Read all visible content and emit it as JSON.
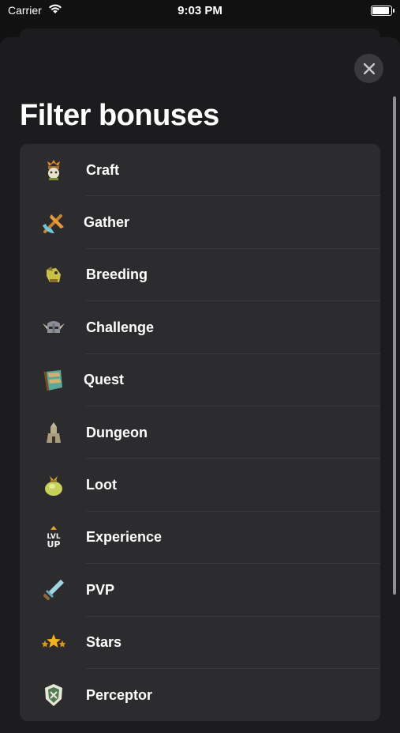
{
  "status": {
    "carrier": "Carrier",
    "time": "9:03 PM"
  },
  "sheet": {
    "title": "Filter bonuses"
  },
  "items": [
    {
      "label": "Craft",
      "icon": "craft-icon"
    },
    {
      "label": "Gather",
      "icon": "gather-icon"
    },
    {
      "label": "Breeding",
      "icon": "breeding-icon"
    },
    {
      "label": "Challenge",
      "icon": "challenge-icon"
    },
    {
      "label": "Quest",
      "icon": "quest-icon"
    },
    {
      "label": "Dungeon",
      "icon": "dungeon-icon"
    },
    {
      "label": "Loot",
      "icon": "loot-icon"
    },
    {
      "label": "Experience",
      "icon": "experience-icon"
    },
    {
      "label": "PVP",
      "icon": "pvp-icon"
    },
    {
      "label": "Stars",
      "icon": "stars-icon"
    },
    {
      "label": "Perceptor",
      "icon": "perceptor-icon"
    }
  ],
  "experience_icon_text": [
    "LVL",
    "UP"
  ]
}
